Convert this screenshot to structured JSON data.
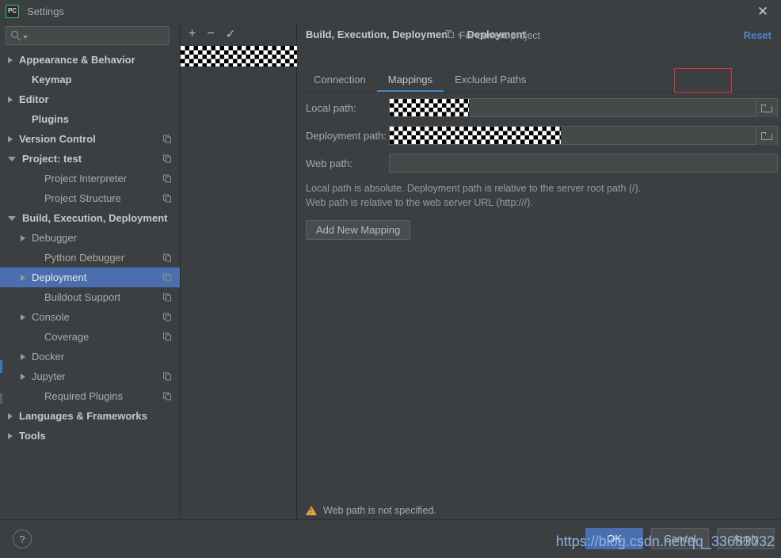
{
  "window": {
    "title": "Settings",
    "app_icon": "PC",
    "close_icon": "✕"
  },
  "search": {
    "value": "",
    "placeholder": "",
    "icon": "search-icon"
  },
  "sidebar": {
    "items": [
      {
        "label": "Appearance & Behavior",
        "arrow": "right",
        "bold": true,
        "indent": 0,
        "copy": false,
        "selected": false
      },
      {
        "label": "Keymap",
        "arrow": "none",
        "bold": true,
        "indent": 1,
        "copy": false,
        "selected": false
      },
      {
        "label": "Editor",
        "arrow": "right",
        "bold": true,
        "indent": 0,
        "copy": false,
        "selected": false
      },
      {
        "label": "Plugins",
        "arrow": "none",
        "bold": true,
        "indent": 1,
        "copy": false,
        "selected": false
      },
      {
        "label": "Version Control",
        "arrow": "right",
        "bold": true,
        "indent": 0,
        "copy": true,
        "selected": false
      },
      {
        "label": "Project: test",
        "arrow": "down",
        "bold": true,
        "indent": 0,
        "copy": true,
        "selected": false
      },
      {
        "label": "Project Interpreter",
        "arrow": "none",
        "bold": false,
        "indent": 2,
        "copy": true,
        "selected": false
      },
      {
        "label": "Project Structure",
        "arrow": "none",
        "bold": false,
        "indent": 2,
        "copy": true,
        "selected": false
      },
      {
        "label": "Build, Execution, Deployment",
        "arrow": "down",
        "bold": true,
        "indent": 0,
        "copy": false,
        "selected": false
      },
      {
        "label": "Debugger",
        "arrow": "right",
        "bold": false,
        "indent": 1,
        "copy": false,
        "selected": false
      },
      {
        "label": "Python Debugger",
        "arrow": "none",
        "bold": false,
        "indent": 2,
        "copy": true,
        "selected": false
      },
      {
        "label": "Deployment",
        "arrow": "right",
        "bold": false,
        "indent": 1,
        "copy": true,
        "selected": true
      },
      {
        "label": "Buildout Support",
        "arrow": "none",
        "bold": false,
        "indent": 2,
        "copy": true,
        "selected": false
      },
      {
        "label": "Console",
        "arrow": "right",
        "bold": false,
        "indent": 1,
        "copy": true,
        "selected": false
      },
      {
        "label": "Coverage",
        "arrow": "none",
        "bold": false,
        "indent": 2,
        "copy": true,
        "selected": false
      },
      {
        "label": "Docker",
        "arrow": "right",
        "bold": false,
        "indent": 1,
        "copy": false,
        "selected": false
      },
      {
        "label": "Jupyter",
        "arrow": "right",
        "bold": false,
        "indent": 1,
        "copy": true,
        "selected": false
      },
      {
        "label": "Required Plugins",
        "arrow": "none",
        "bold": false,
        "indent": 2,
        "copy": true,
        "selected": false
      },
      {
        "label": "Languages & Frameworks",
        "arrow": "right",
        "bold": true,
        "indent": 0,
        "copy": false,
        "selected": false
      },
      {
        "label": "Tools",
        "arrow": "right",
        "bold": true,
        "indent": 0,
        "copy": false,
        "selected": false
      }
    ]
  },
  "servers": {
    "toolbar": {
      "add": "+",
      "remove": "−",
      "set_default": "✓"
    },
    "entries": [
      {
        "label": "",
        "redacted": true
      }
    ]
  },
  "main": {
    "breadcrumb": {
      "parent": "Build, Execution, Deployment",
      "separator": "›",
      "current": "Deployment"
    },
    "scope_label": "For current project",
    "reset_label": "Reset",
    "tabs": [
      {
        "label": "Connection",
        "active": false
      },
      {
        "label": "Mappings",
        "active": true
      },
      {
        "label": "Excluded Paths",
        "active": false
      }
    ],
    "form": {
      "local_path": {
        "label": "Local path:",
        "value": "",
        "redacted": true,
        "browse_icon": "folder-icon"
      },
      "deployment_path": {
        "label": "Deployment path:",
        "value": "",
        "redacted": true,
        "browse_icon": "folder-icon"
      },
      "web_path": {
        "label": "Web path:",
        "value": "",
        "redacted": false,
        "browse_icon": ""
      }
    },
    "hint_line1": "Local path is absolute. Deployment path is relative to the server root path (/).",
    "hint_line2": "Web path is relative to the web server URL (http:///).",
    "add_mapping_label": "Add New Mapping",
    "warning": {
      "icon": "warning-triangle-icon",
      "text": "Web path is not specified."
    }
  },
  "footer": {
    "help_label": "?",
    "buttons": [
      {
        "label": "OK",
        "primary": true
      },
      {
        "label": "Cancel",
        "primary": false
      },
      {
        "label": "Apply",
        "primary": false
      }
    ],
    "watermark": "https://blog.csdn.net/qq_33683032"
  },
  "colors": {
    "background": "#3c3f41",
    "selection": "#4b6eaf",
    "accent_link": "#4a88c7",
    "warning": "#e8a33d",
    "annotation": "#e03030"
  }
}
